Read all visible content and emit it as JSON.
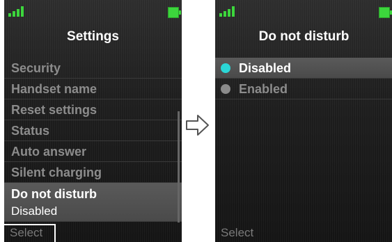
{
  "left_screen": {
    "title": "Settings",
    "menu": [
      {
        "label": "Security"
      },
      {
        "label": "Handset name"
      },
      {
        "label": "Reset settings"
      },
      {
        "label": "Status"
      },
      {
        "label": "Auto answer"
      },
      {
        "label": "Silent charging"
      }
    ],
    "selected_item": {
      "label": "Do not disturb",
      "value": "Disabled"
    },
    "softkey": "Select"
  },
  "right_screen": {
    "title": "Do not disturb",
    "options": [
      {
        "label": "Disabled",
        "selected": true
      },
      {
        "label": "Enabled",
        "selected": false
      }
    ],
    "softkey": "Select"
  },
  "colors": {
    "signal": "#3cd63c",
    "battery": "#3cd63c",
    "radio_selected": "#2bd6d6"
  },
  "icons": {
    "signal": "signal-bars-icon",
    "battery": "battery-icon",
    "transition_arrow": "arrow-right-icon"
  }
}
